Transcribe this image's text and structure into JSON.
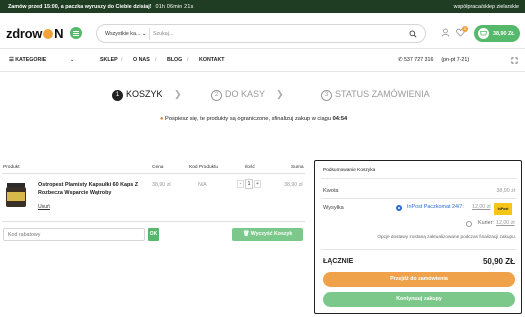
{
  "topbar": {
    "promo": "Zamów przed 15:00, a paczka wyruszy do Ciebie dzisiaj!",
    "timer": "01h  06min  21s",
    "cooperation": "współpraca/sklep zielarskie"
  },
  "logo": {
    "text_left": "zdrow",
    "text_right": "N"
  },
  "search": {
    "category": "Wszystkie ka...",
    "placeholder": "Szukaj..."
  },
  "cart": {
    "badge": "0",
    "total": "38,90 ZŁ"
  },
  "nav": {
    "categories": "KATEGORIE",
    "items": [
      "SKLEP",
      "O NAS",
      "BLOG",
      "KONTAKT"
    ],
    "phone": "537 727 316",
    "hours": "(pn-pt 7-21)"
  },
  "steps": [
    {
      "num": "1",
      "label": "KOSZYK"
    },
    {
      "num": "2",
      "label": "DO KASY"
    },
    {
      "num": "3",
      "label": "STATUS ZAMÓWIENIA"
    }
  ],
  "step_separator": "❯",
  "hurry": {
    "text": "Pospiesz się, te produkty są ograniczone, sfinalizuj zakup w ciągu",
    "time": "04:54"
  },
  "table": {
    "headers": [
      "Produkt",
      "Cena",
      "Kod Produktu",
      "Ilość",
      "Suma"
    ],
    "row": {
      "name": "Ostropest Plamisty Kapsułki 60 Kaps Z Rozbecza Wsparcie Wątroby",
      "remove": "Usuń",
      "price": "38,90 zł",
      "code": "N/A",
      "qty": "1",
      "sum": "38,90 zł"
    }
  },
  "coupon": {
    "placeholder": "Kod rabatowy",
    "ok": "OK",
    "clear": "Wyczyść Koszyk"
  },
  "summary": {
    "title": "Podsumowanie Koszyka",
    "subtotal_label": "Kwota",
    "subtotal_value": "38,90 zł",
    "shipping_label": "Wysyłka",
    "options": [
      {
        "name": "InPost Paczkomat 24/7:",
        "price": "12,00 zł",
        "selected": true
      },
      {
        "name": "Kurier:",
        "price": "12,00 zł",
        "selected": false
      }
    ],
    "inpost_logo": "InPost",
    "note": "Opcje dostawy zostaną zaktualizowane podczas finalizacji zakupu.",
    "total_label": "ŁĄCZNIE",
    "total_value": "50,90 ZŁ",
    "order_button": "Przejdź do zamówienia",
    "continue_button": "Kontynuuj zakupy"
  },
  "colors": {
    "dark_green": "#1f3d22",
    "green": "#55b86a",
    "orange": "#f0a24a",
    "blue": "#2d6bd6"
  }
}
